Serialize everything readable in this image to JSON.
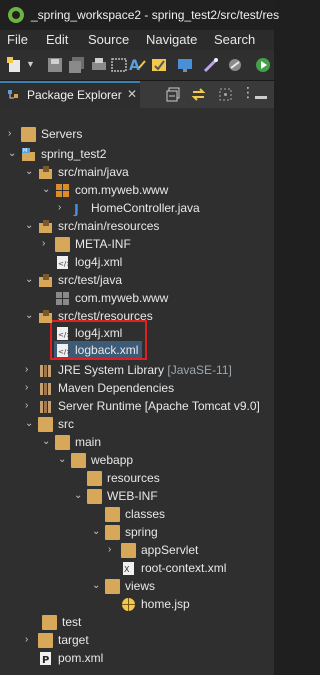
{
  "window": {
    "title": "_spring_workspace2 - spring_test2/src/test/res"
  },
  "menu": [
    "File",
    "Edit",
    "Source",
    "Navigate",
    "Search"
  ],
  "view": {
    "tab_label": "Package Explorer"
  },
  "tree": [
    {
      "label": "Servers"
    },
    {
      "label": "spring_test2"
    },
    {
      "label": "src/main/java"
    },
    {
      "label": "com.myweb.www"
    },
    {
      "label": "HomeController.java"
    },
    {
      "label": "src/main/resources"
    },
    {
      "label": "META-INF"
    },
    {
      "label": "log4j.xml"
    },
    {
      "label": "src/test/java"
    },
    {
      "label": "com.myweb.www"
    },
    {
      "label": "src/test/resources"
    },
    {
      "label": "log4j.xml"
    },
    {
      "label": "logback.xml"
    },
    {
      "label": "JRE System Library",
      "decoration": "[JavaSE-11]"
    },
    {
      "label": "Maven Dependencies"
    },
    {
      "label": "Server Runtime [Apache Tomcat v9.0]"
    },
    {
      "label": "src"
    },
    {
      "label": "main"
    },
    {
      "label": "webapp"
    },
    {
      "label": "resources"
    },
    {
      "label": "WEB-INF"
    },
    {
      "label": "classes"
    },
    {
      "label": "spring"
    },
    {
      "label": "appServlet"
    },
    {
      "label": "root-context.xml"
    },
    {
      "label": "views"
    },
    {
      "label": "home.jsp"
    },
    {
      "label": "test"
    },
    {
      "label": "target"
    },
    {
      "label": "pom.xml"
    }
  ]
}
